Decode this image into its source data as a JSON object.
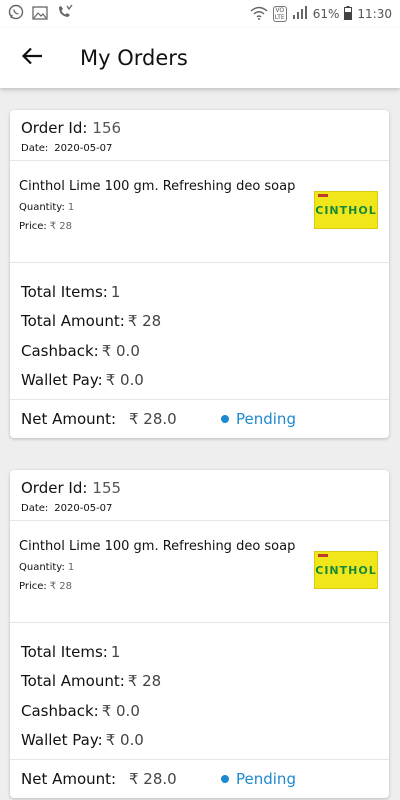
{
  "status_bar": {
    "battery": "61%",
    "time": "11:30",
    "network_badge_top": "VO",
    "network_badge_bottom": "LTE",
    "icons": [
      "whatsapp-icon",
      "image-icon",
      "missed-call-icon",
      "wifi-icon",
      "signal-icon",
      "battery-icon"
    ]
  },
  "app_bar": {
    "title": "My Orders",
    "back_icon": "arrow-left-icon"
  },
  "labels": {
    "order_id": "Order Id:",
    "date": "Date:",
    "quantity": "Quantity:",
    "price": "Price:",
    "total_items": "Total Items:",
    "total_amount": "Total Amount:",
    "cashback": "Cashback:",
    "wallet_pay": "Wallet Pay:",
    "net_amount": "Net Amount:"
  },
  "orders": [
    {
      "id": "156",
      "date": "2020-05-07",
      "item": {
        "name": "Cinthol Lime 100 gm. Refreshing deo soap",
        "quantity": "1",
        "price": "₹ 28",
        "image_brand": "CINTHOL"
      },
      "total_items": "1",
      "total_amount": "₹ 28",
      "cashback": "₹ 0.0",
      "wallet_pay": "₹ 0.0",
      "net_amount": "₹ 28.0",
      "status": "Pending"
    },
    {
      "id": "155",
      "date": "2020-05-07",
      "item": {
        "name": "Cinthol Lime 100 gm. Refreshing deo soap",
        "quantity": "1",
        "price": "₹ 28",
        "image_brand": "CINTHOL"
      },
      "total_items": "1",
      "total_amount": "₹ 28",
      "cashback": "₹ 0.0",
      "wallet_pay": "₹ 0.0",
      "net_amount": "₹ 28.0",
      "status": "Pending"
    }
  ],
  "colors": {
    "status_pending": "#1e88d0",
    "background": "#eeeeee",
    "card": "#ffffff",
    "soap_yellow": "#f0e61a",
    "soap_green": "#1a8a3a"
  }
}
